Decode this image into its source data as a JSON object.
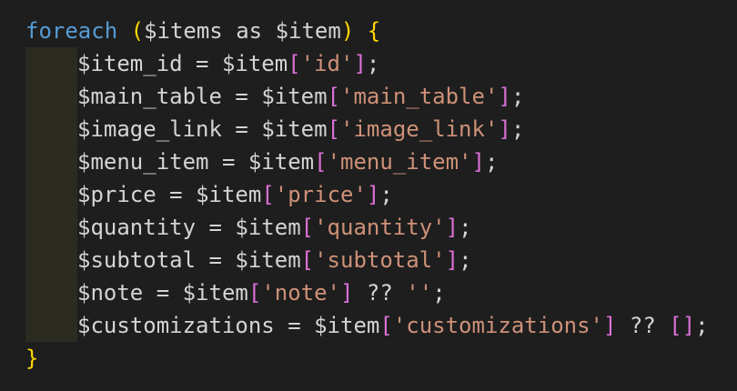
{
  "editor": {
    "lines": [
      {
        "kw": "foreach",
        "paren_open": "(",
        "subject": "$items",
        "as": "as",
        "alias": "$item",
        "paren_close": ")",
        "brace": "{"
      },
      {
        "var": "$item_id",
        "op": "=",
        "src": "$item",
        "key": "'id'",
        "tail": ";"
      },
      {
        "var": "$main_table",
        "op": "=",
        "src": "$item",
        "key": "'main_table'",
        "tail": ";"
      },
      {
        "var": "$image_link",
        "op": "=",
        "src": "$item",
        "key": "'image_link'",
        "tail": ";"
      },
      {
        "var": "$menu_item",
        "op": "=",
        "src": "$item",
        "key": "'menu_item'",
        "tail": ";"
      },
      {
        "var": "$price",
        "op": "=",
        "src": "$item",
        "key": "'price'",
        "tail": ";"
      },
      {
        "var": "$quantity",
        "op": "=",
        "src": "$item",
        "key": "'quantity'",
        "tail": ";"
      },
      {
        "var": "$subtotal",
        "op": "=",
        "src": "$item",
        "key": "'subtotal'",
        "tail": ";"
      },
      {
        "var": "$note",
        "op": "=",
        "src": "$item",
        "key": "'note'",
        "coalesce": "??",
        "default": "''",
        "tail": ";"
      },
      {
        "var": "$customizations",
        "op": "=",
        "src": "$item",
        "key": "'customizations'",
        "coalesce": "??",
        "default": "[]",
        "tail": ";"
      },
      {
        "brace": "}"
      }
    ],
    "colors": {
      "background": "#1e1e1e",
      "keyword": "#569cd6",
      "brace": "#ffd700",
      "bracket": "#da70d6",
      "string": "#ce9178",
      "text": "#d4d4d4",
      "indent_guide": "#2b2b22"
    }
  }
}
